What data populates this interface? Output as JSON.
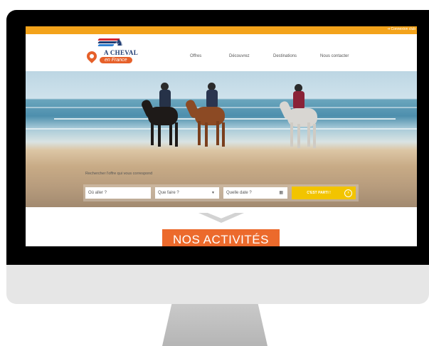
{
  "topbar": {
    "login_label": "Connexion club",
    "login_icon": "login-icon"
  },
  "brand": {
    "name": "A CHEVAL",
    "tagline": "en France",
    "stripe_colors": [
      "#d62631",
      "#1f3c73",
      "#2d7fd1"
    ]
  },
  "nav": {
    "items": [
      "Offres",
      "Découvrez",
      "Destinations",
      "Nous contacter"
    ]
  },
  "search": {
    "label": "Rechercher l'offre qui vous correspond",
    "where_placeholder": "Où aller ?",
    "what_placeholder": "Que faire ?",
    "date_placeholder": "Quelle date ?",
    "submit_label": "C'EST PARTI !"
  },
  "section": {
    "title": "NOS ACTIVITÉS"
  },
  "colors": {
    "accent": "#f3a31b",
    "cta": "#f2c400",
    "section": "#ec6a2c",
    "brand_navy": "#1f3c73"
  }
}
